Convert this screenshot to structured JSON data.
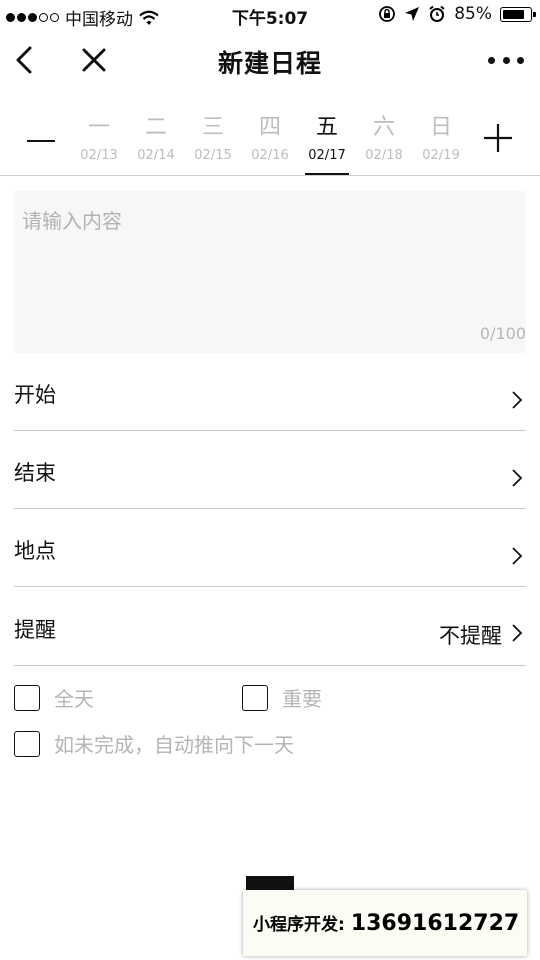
{
  "status_bar": {
    "carrier": "中国移动",
    "time": "下午5:07",
    "battery_percent_label": "85%",
    "battery_level": 0.85,
    "signal_dots_filled": 3,
    "signal_dots_total": 5,
    "icons": [
      "wifi-icon",
      "rotation-lock-icon",
      "location-icon",
      "alarm-icon",
      "battery-icon"
    ]
  },
  "nav": {
    "title": "新建日程",
    "icons": [
      "back-icon",
      "close-icon",
      "more-icon"
    ]
  },
  "week": {
    "prev_icon": "minus-icon",
    "next_icon": "plus-icon",
    "active_index": 4,
    "days": [
      {
        "name": "一",
        "date": "02/13"
      },
      {
        "name": "二",
        "date": "02/14"
      },
      {
        "name": "三",
        "date": "02/15"
      },
      {
        "name": "四",
        "date": "02/16"
      },
      {
        "name": "五",
        "date": "02/17"
      },
      {
        "name": "六",
        "date": "02/18"
      },
      {
        "name": "日",
        "date": "02/19"
      }
    ]
  },
  "content": {
    "placeholder": "请输入内容",
    "counter": "0/100"
  },
  "rows": {
    "start": {
      "label": "开始"
    },
    "end": {
      "label": "结束"
    },
    "location": {
      "label": "地点"
    },
    "reminder": {
      "label": "提醒",
      "value": "不提醒"
    }
  },
  "options": {
    "all_day": "全天",
    "important": "重要",
    "auto_postpone": "如未完成，自动推向下一天"
  },
  "watermark": {
    "label": "小程序开发:",
    "number": "13691612727"
  }
}
